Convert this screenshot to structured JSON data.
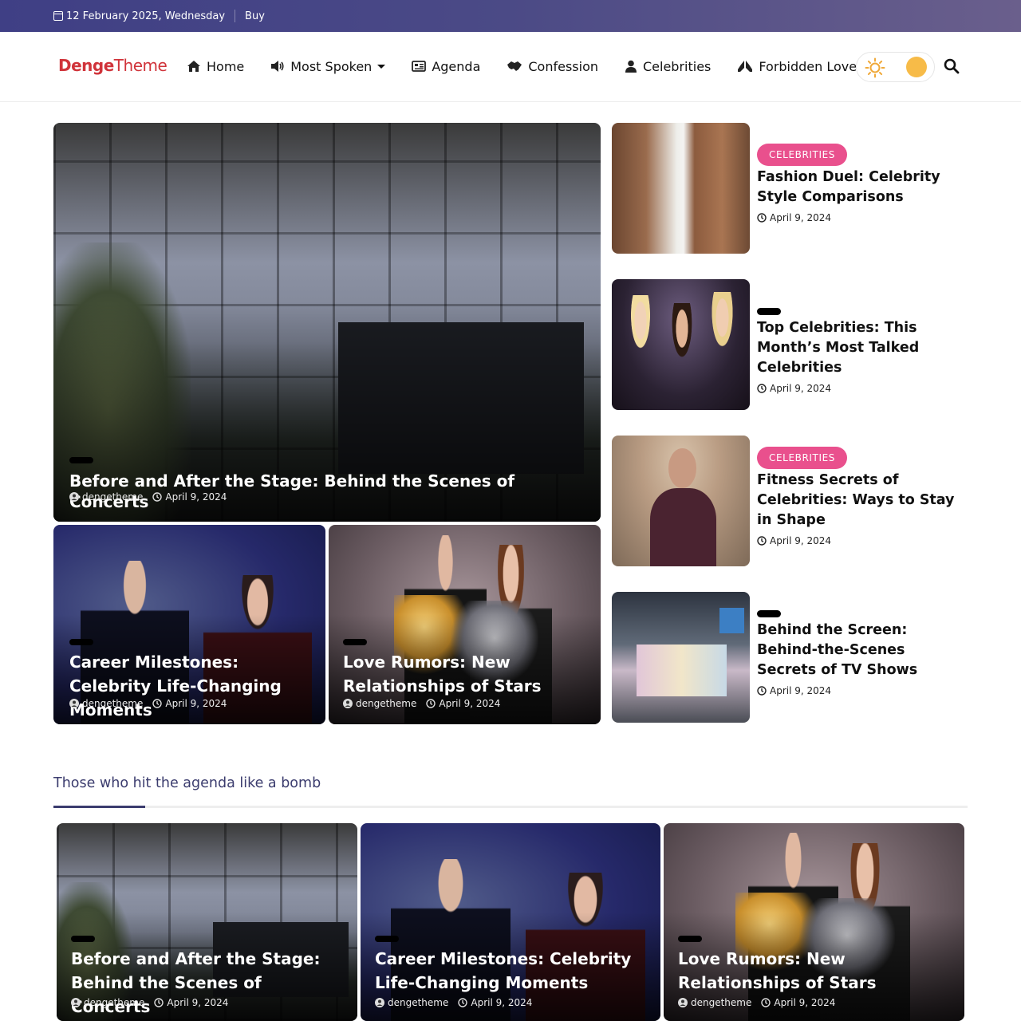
{
  "topbar": {
    "date": "12 February 2025, Wednesday",
    "buy_label": "Buy"
  },
  "logo": {
    "bold": "Denge",
    "light": "Theme"
  },
  "nav": [
    {
      "label": "Home",
      "icon": "home-icon"
    },
    {
      "label": "Most Spoken",
      "icon": "megaphone-icon",
      "dropdown": true
    },
    {
      "label": "Agenda",
      "icon": "newspaper-icon"
    },
    {
      "label": "Confession",
      "icon": "handshake-icon"
    },
    {
      "label": "Celebrities",
      "icon": "user-icon"
    },
    {
      "label": "Forbidden Love",
      "icon": "praying-hands-icon"
    }
  ],
  "colors": {
    "accent": "#3b3c6e",
    "brand": "#d0333a",
    "badge": "#e9508d",
    "toggle_knob": "#f7bb48"
  },
  "featured": {
    "main": {
      "title": "Before and After the Stage: Behind the Scenes of Concerts",
      "author": "dengetheme",
      "date": "April 9, 2024"
    },
    "left": {
      "title": "Career Milestones: Celebrity Life-Changing Moments",
      "author": "dengetheme",
      "date": "April 9, 2024"
    },
    "right": {
      "title": "Love Rumors: New Relationships of Stars",
      "author": "dengetheme",
      "date": "April 9, 2024"
    }
  },
  "side_list": [
    {
      "category": "CELEBRITIES",
      "title": "Fashion Duel: Celebrity Style Comparisons",
      "date": "April 9, 2024"
    },
    {
      "category": "",
      "title": "Top Celebrities: This Month’s Most Talked Celebrities",
      "date": "April 9, 2024"
    },
    {
      "category": "CELEBRITIES",
      "title": "Fitness Secrets of Celebrities: Ways to Stay in Shape",
      "date": "April 9, 2024"
    },
    {
      "category": "",
      "title": "Behind the Screen: Behind-the-Scenes Secrets of TV Shows",
      "date": "April 9, 2024"
    }
  ],
  "section": {
    "title": "Those who hit the agenda like a bomb",
    "cards": [
      {
        "title": "Before and After the Stage: Behind the Scenes of Concerts",
        "author": "dengetheme",
        "date": "April 9, 2024"
      },
      {
        "title": "Career Milestones: Celebrity Life-Changing Moments",
        "author": "dengetheme",
        "date": "April 9, 2024"
      },
      {
        "title": "Love Rumors: New Relationships of Stars",
        "author": "dengetheme",
        "date": "April 9, 2024"
      }
    ]
  }
}
